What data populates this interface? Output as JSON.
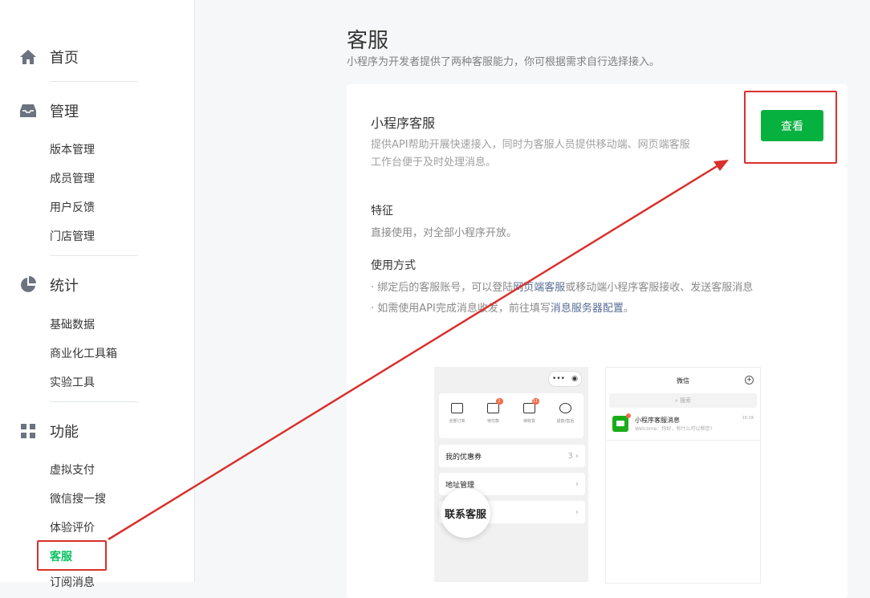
{
  "sidebar": {
    "sections": [
      {
        "label": "首页",
        "icon": "home-icon"
      },
      {
        "label": "管理",
        "icon": "inbox-icon"
      },
      {
        "label": "统计",
        "icon": "pie-chart-icon"
      },
      {
        "label": "功能",
        "icon": "grid-icon"
      }
    ],
    "manage_items": [
      "版本管理",
      "成员管理",
      "用户反馈",
      "门店管理"
    ],
    "stats_items": [
      "基础数据",
      "商业化工具箱",
      "实验工具"
    ],
    "feature_items": [
      "虚拟支付",
      "微信搜一搜",
      "体验评价",
      "客服",
      "订阅消息"
    ]
  },
  "main": {
    "title": "客服",
    "subtitle": "小程序为开发者提供了两种客服能力，你可根据需求自行选择接入。",
    "card": {
      "title": "小程序客服",
      "desc_line1": "提供API帮助开展快速接入，同时为客服人员提供移动端、网页端客服",
      "desc_line2": "工作台便于及时处理消息。",
      "button": "查看",
      "features_heading": "特征",
      "features_text": "直接使用，对全部小程序开放。",
      "usage_heading": "使用方式",
      "usage1_pre": "· 绑定后的客服账号，可以登陆",
      "usage1_link": "网页端客服",
      "usage1_post": "或移动端小程序客服接收、发送客服消息",
      "usage2_pre": "· 如需使用API完成消息收发，前往填写",
      "usage2_link": "消息服务器配置",
      "usage2_post": "。"
    }
  },
  "mock_left": {
    "capsule": "•••",
    "orders": [
      {
        "label": "全部订单",
        "badge": ""
      },
      {
        "label": "待付款",
        "badge": "1"
      },
      {
        "label": "待收货",
        "badge": "11"
      },
      {
        "label": "退款/售后",
        "badge": ""
      }
    ],
    "rows": [
      {
        "label": "我的优惠券",
        "right": "3 ›"
      },
      {
        "label": "地址管理",
        "right": "›"
      },
      {
        "label": "",
        "right": "›"
      }
    ],
    "bubble": "联系客服"
  },
  "mock_right": {
    "title": "微信",
    "plus": "+",
    "search": "⌕ 搜索",
    "msg_title": "小程序客服消息",
    "msg_snippet": "Welcome：你好，有什么可以帮您?",
    "msg_time": "16:04"
  },
  "colors": {
    "accent": "#07c160",
    "button": "#07b140",
    "annotation": "#d9302c",
    "link": "#576b95"
  }
}
